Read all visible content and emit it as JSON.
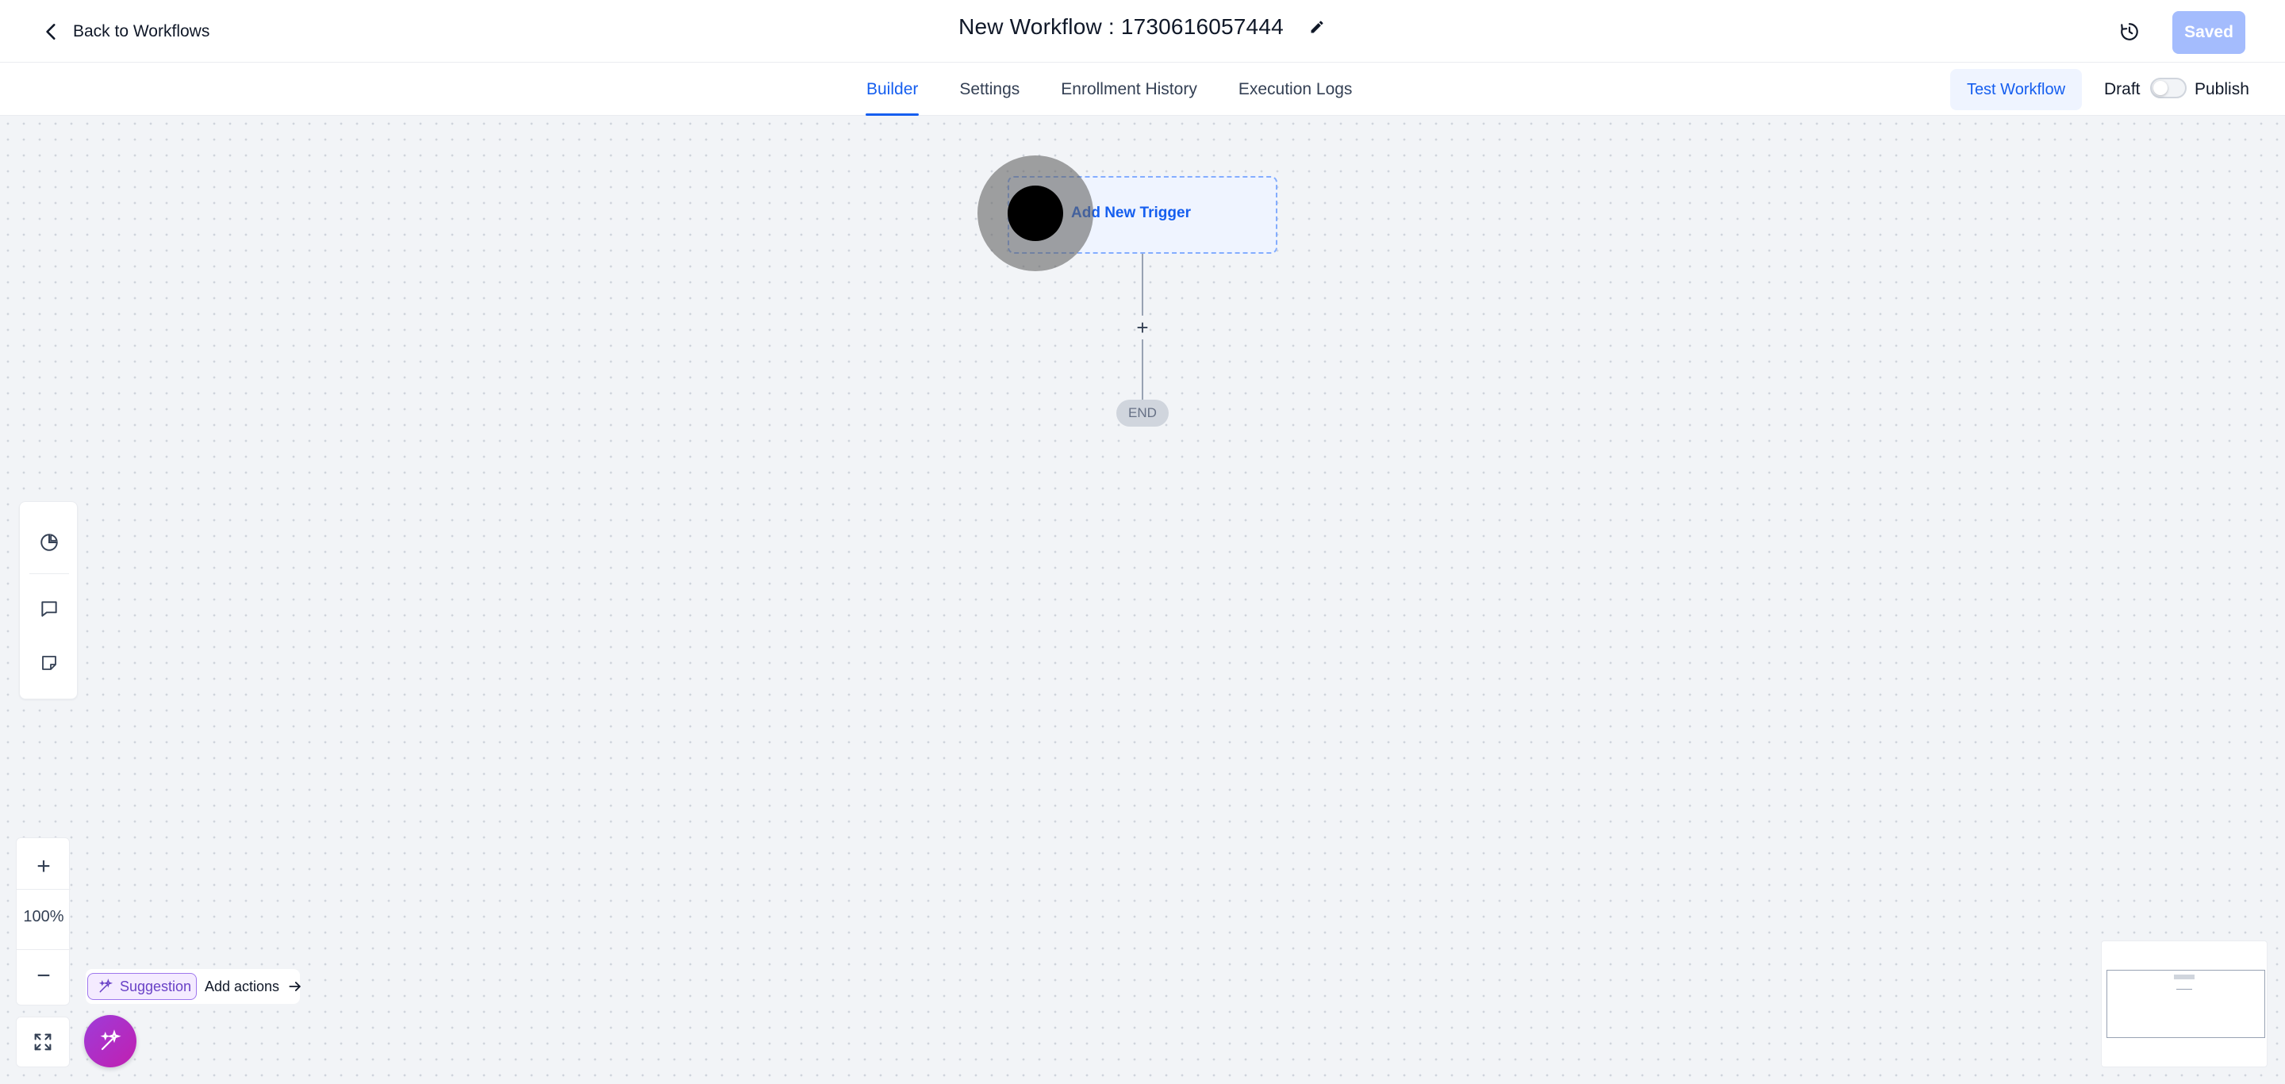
{
  "header": {
    "back_label": "Back to Workflows",
    "workflow_title": "New Workflow : 1730616057444",
    "saved_label": "Saved"
  },
  "tabs": [
    {
      "label": "Builder",
      "active": true
    },
    {
      "label": "Settings",
      "active": false
    },
    {
      "label": "Enrollment History",
      "active": false
    },
    {
      "label": "Execution Logs",
      "active": false
    }
  ],
  "actions": {
    "test_label": "Test Workflow",
    "draft_label": "Draft",
    "publish_label": "Publish",
    "publish_enabled": false
  },
  "canvas": {
    "trigger_label": "Add New Trigger",
    "end_label": "END",
    "add_step_symbol": "+"
  },
  "zoom": {
    "in_symbol": "+",
    "level": "100%",
    "out_symbol": "−"
  },
  "suggestion": {
    "pill_label": "Suggestion",
    "action_label": "Add actions"
  },
  "colors": {
    "accent": "#155eef",
    "saved_button": "#a4bcfd",
    "suggestion": "#6941c6",
    "ai_fab": "#b42bc7"
  },
  "icons": {
    "back": "chevron-left-icon",
    "edit": "pencil-icon",
    "history": "clock-history-icon",
    "stats": "pie-chart-icon",
    "comment": "comment-icon",
    "note": "sticky-note-icon",
    "fit": "expand-icon",
    "ai": "sparkle-icon",
    "arrow": "arrow-right-icon"
  }
}
